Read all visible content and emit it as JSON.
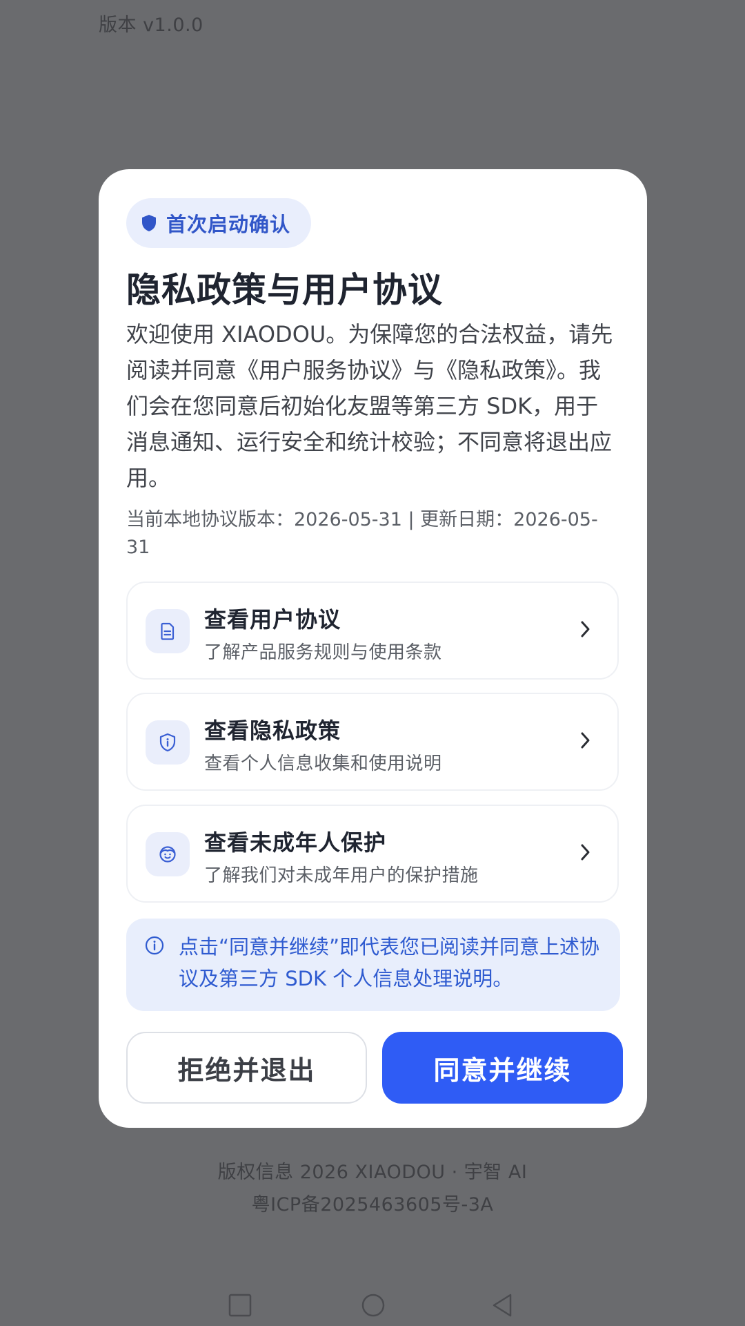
{
  "status": {
    "version_label": "版本 v1.0.0"
  },
  "dialog": {
    "badge_label": "首次启动确认",
    "title": "隐私政策与用户协议",
    "intro": "欢迎使用 XIAODOU。为保障您的合法权益，请先阅读并同意《用户服务协议》与《隐私政策》。我们会在您同意后初始化友盟等第三方 SDK，用于消息通知、运行安全和统计校验；不同意将退出应用。",
    "meta": "当前本地协议版本：2026-05-31 | 更新日期：2026-05-31",
    "links": [
      {
        "title": "查看用户协议",
        "subtitle": "了解产品服务规则与使用条款",
        "icon": "document-icon"
      },
      {
        "title": "查看隐私政策",
        "subtitle": "查看个人信息收集和使用说明",
        "icon": "shield-info-icon"
      },
      {
        "title": "查看未成年人保护",
        "subtitle": "了解我们对未成年用户的保护措施",
        "icon": "child-face-icon"
      }
    ],
    "notice": "点击“同意并继续”即代表您已阅读并同意上述协议及第三方 SDK 个人信息处理说明。",
    "reject_label": "拒绝并退出",
    "agree_label": "同意并继续"
  },
  "footer": {
    "copyright": "版权信息 2026 XIAODOU · 宇智 AI",
    "icp": "粤ICP备2025463605号-3A"
  },
  "colors": {
    "accent": "#2f5cf5",
    "accent_text": "#3156c8",
    "overlay": "#6a6b6e"
  }
}
